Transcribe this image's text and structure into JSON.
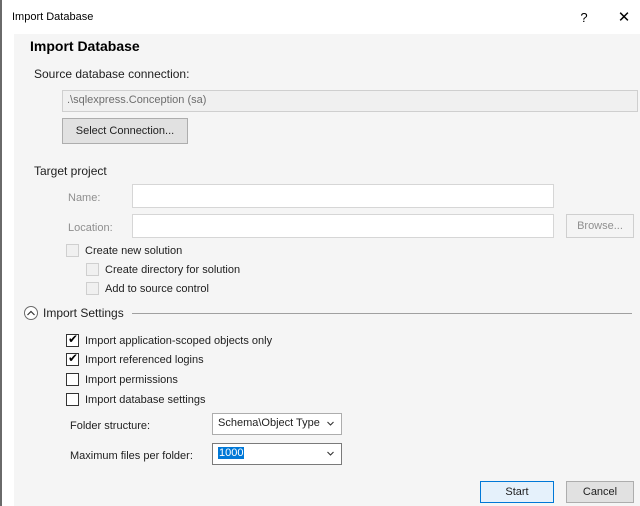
{
  "window": {
    "title": "Import Database",
    "help_glyph": "?",
    "close_glyph": "✕"
  },
  "heading": "Import Database",
  "source": {
    "label": "Source database connection:",
    "connection_value": ".\\sqlexpress.Conception (sa)",
    "select_button": "Select Connection..."
  },
  "target": {
    "label": "Target project",
    "name_label": "Name:",
    "location_label": "Location:",
    "browse_button": "Browse...",
    "create_solution": "Create new solution",
    "create_directory": "Create directory for solution",
    "add_source_control": "Add to source control"
  },
  "import_settings": {
    "label": "Import Settings",
    "options": [
      {
        "label": "Import application-scoped objects only",
        "checked": true
      },
      {
        "label": "Import referenced logins",
        "checked": true
      },
      {
        "label": "Import permissions",
        "checked": false
      },
      {
        "label": "Import database settings",
        "checked": false
      }
    ],
    "folder_structure_label": "Folder structure:",
    "folder_structure_value": "Schema\\Object Type",
    "max_files_label": "Maximum files per folder:",
    "max_files_value": "1000"
  },
  "footer": {
    "start_button": "Start",
    "cancel_button": "Cancel"
  }
}
